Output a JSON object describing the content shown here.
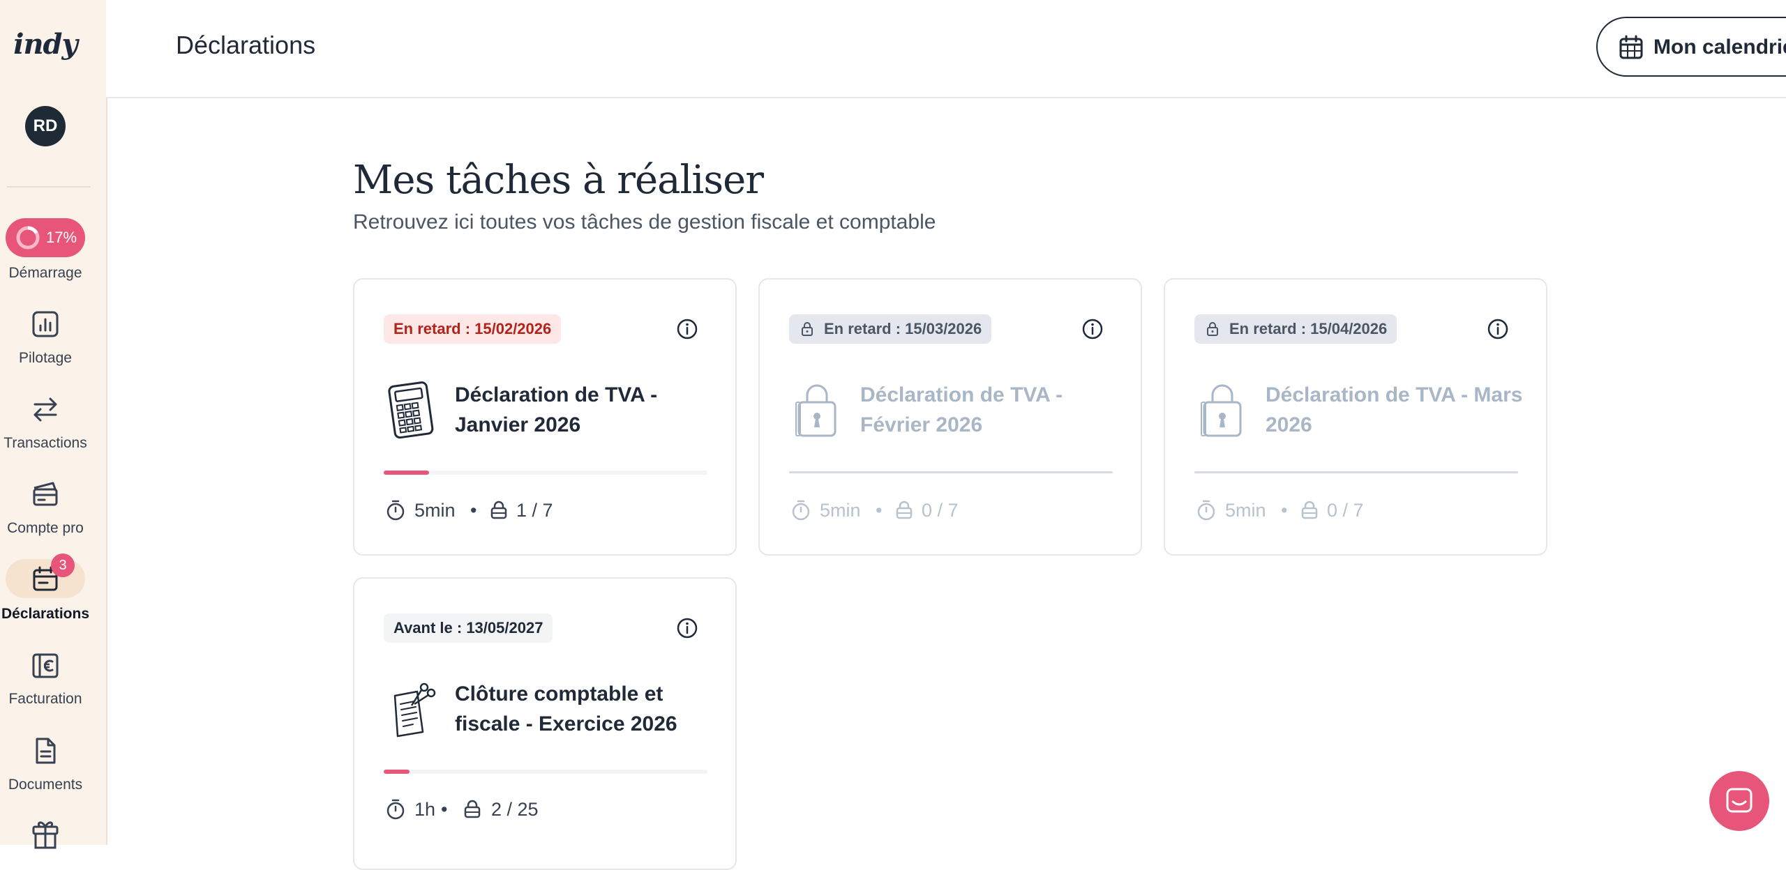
{
  "app": {
    "logo": "indy",
    "avatar_initials": "RD"
  },
  "sidebar": {
    "progress": {
      "value": 0.17,
      "label": "17%"
    },
    "items": [
      {
        "label": "Démarrage",
        "icon": "progress-ring-icon"
      },
      {
        "label": "Pilotage",
        "icon": "chart-icon"
      },
      {
        "label": "Transactions",
        "icon": "swap-arrows-icon"
      },
      {
        "label": "Compte pro",
        "icon": "card-icon"
      },
      {
        "label": "Déclarations",
        "icon": "calendar-icon",
        "active": true,
        "badge": "3"
      },
      {
        "label": "Facturation",
        "icon": "euro-doc-icon"
      },
      {
        "label": "Documents",
        "icon": "document-icon"
      },
      {
        "label": "",
        "icon": "gift-icon"
      }
    ]
  },
  "header": {
    "title": "Déclarations",
    "calendar_button": "Mon calendrier"
  },
  "main": {
    "title": "Mes tâches à réaliser",
    "subtitle": "Retrouvez ici toutes vos tâches de gestion fiscale et comptable",
    "cards": [
      {
        "tag": "En retard : 15/02/2026",
        "title": "Déclaration de TVA - Janvier 2026",
        "duration": "5min",
        "steps": "1 / 7",
        "progress": 0.14,
        "locked": false,
        "illustration": "calculator-icon"
      },
      {
        "tag": "En retard : 15/03/2026",
        "title": "Déclaration de TVA - Février 2026",
        "duration": "5min",
        "steps": "0 / 7",
        "progress": 0,
        "locked": true,
        "illustration": "padlock-icon"
      },
      {
        "tag": "En retard : 15/04/2026",
        "title": "Déclaration de TVA - Mars 2026",
        "duration": "5min",
        "steps": "0 / 7",
        "progress": 0,
        "locked": true,
        "illustration": "padlock-icon"
      },
      {
        "tag": "Avant le : 13/05/2027",
        "title": "Clôture comptable et fiscale - Exercice 2026",
        "duration": "1h",
        "steps": "2 / 25",
        "progress": 0.08,
        "locked": false,
        "illustration": "receipt-scissors-icon"
      }
    ]
  },
  "colors": {
    "accent": "#e8557a",
    "sidebar_bg": "#fbf3ea",
    "late_tag_bg": "#fde7e7",
    "late_tag_text": "#b42318",
    "locked_text": "#a9b6c6"
  }
}
